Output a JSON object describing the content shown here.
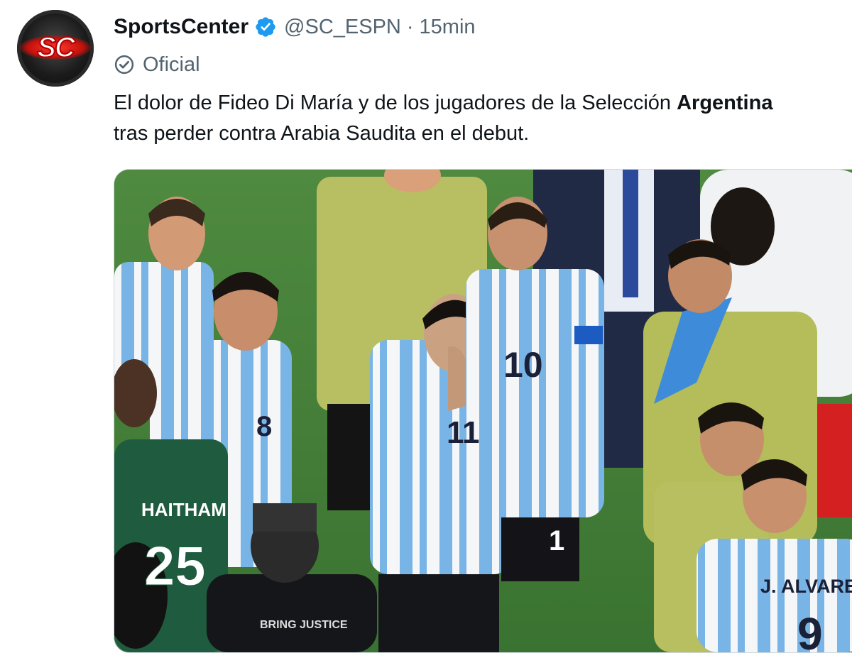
{
  "tweet": {
    "author_name": "SportsCenter",
    "handle": "@SC_ESPN",
    "separator": "·",
    "time": "15min",
    "badge_label": "Oficial",
    "avatar_logo": "SC",
    "text_part1": "El dolor de Fideo Di María y de los jugadores de la Selección ",
    "text_bold": "Argentina",
    "text_part2": "tras perder contra Arabia Saudita en el debut.",
    "accent_color": "#1d9bf0"
  },
  "media": {
    "jersey_texts": {
      "saudi_name": "HAITHAM",
      "saudi_number": "25",
      "number_8": "8",
      "number_11": "11",
      "number_10": "10",
      "number_1": "1",
      "alvarez_name": "J. ALVAREZ",
      "alvarez_number": "9",
      "photographer_shirt": "BRING JUSTICE"
    }
  }
}
